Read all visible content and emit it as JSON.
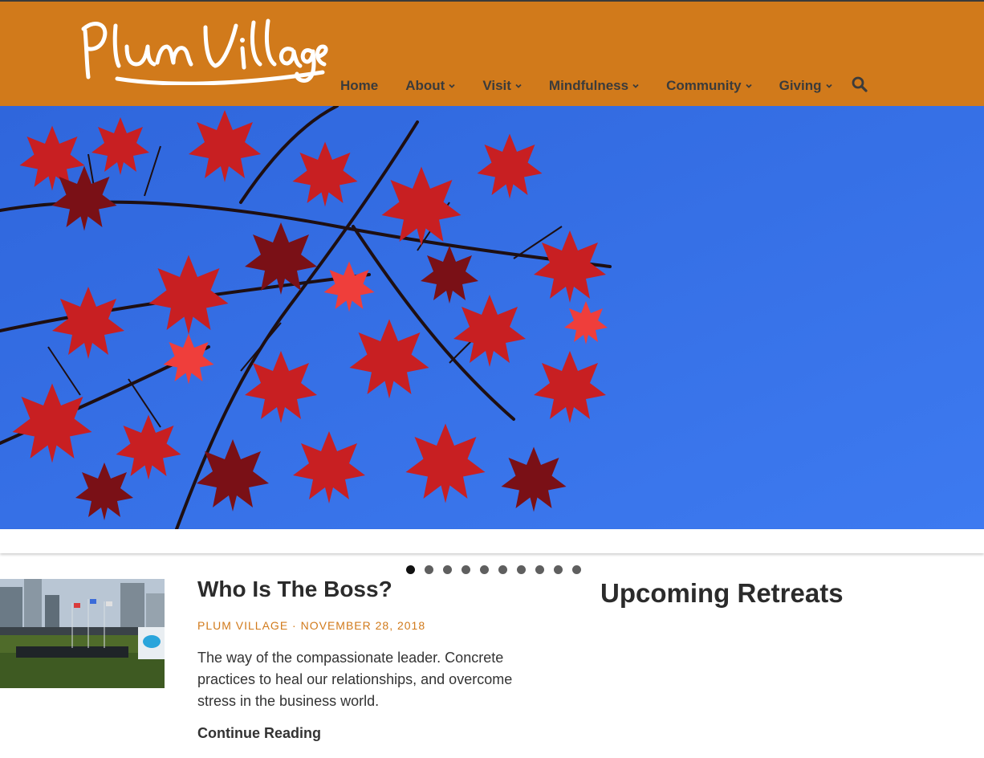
{
  "site": {
    "logo_text": "Plum Village",
    "brand_color": "#d17a1b"
  },
  "nav": {
    "items": [
      {
        "label": "Home",
        "has_dropdown": false
      },
      {
        "label": "About",
        "has_dropdown": true
      },
      {
        "label": "Visit",
        "has_dropdown": true
      },
      {
        "label": "Mindfulness",
        "has_dropdown": true
      },
      {
        "label": "Community",
        "has_dropdown": true
      },
      {
        "label": "Giving",
        "has_dropdown": true
      }
    ],
    "search_icon": "search-icon",
    "dropdown_icon": "chevron-down-icon"
  },
  "hero": {
    "image": "red maple leaves against a blue sky",
    "slide_count": 10,
    "active_slide": 1
  },
  "post": {
    "title": "Who Is The Boss?",
    "author": "PLUM VILLAGE",
    "separator": "·",
    "date": "NOVEMBER 28, 2018",
    "excerpt": "The way of the compassionate leader. Concrete practices to heal our relationships, and overcome stress in the business world.",
    "continue_label": "Continue Reading"
  },
  "sidebar": {
    "heading": "Upcoming Retreats"
  }
}
